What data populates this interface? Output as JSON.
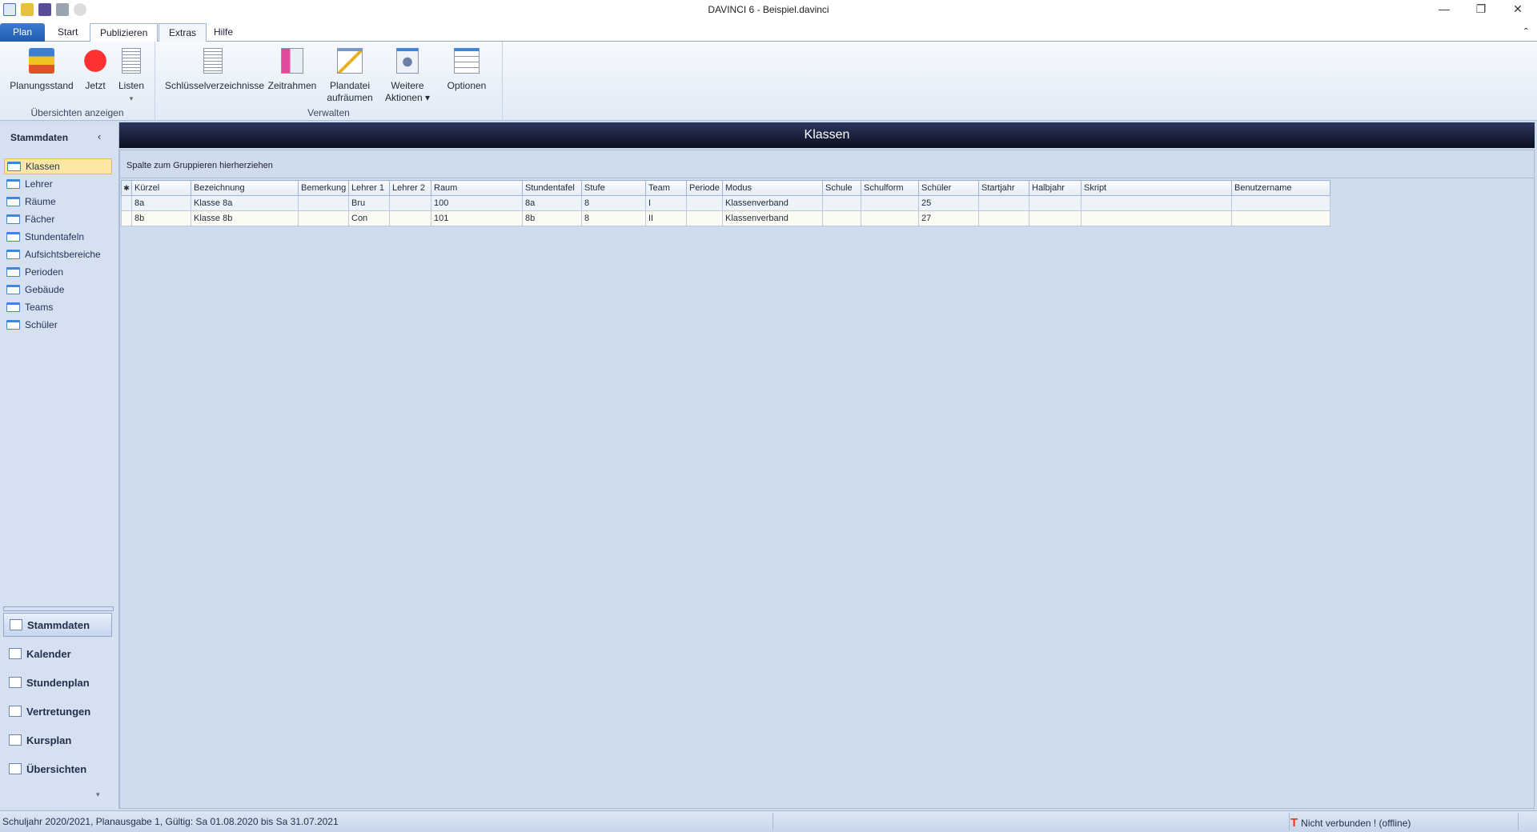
{
  "window": {
    "title": "DAVINCI 6 - Beispiel.davinci",
    "minimize": "—",
    "restore": "❐",
    "close": "✕",
    "collapse_ribbon": "⌃"
  },
  "quick_access": [
    "app-icon",
    "open-icon",
    "save-icon",
    "print-icon",
    "refresh-icon"
  ],
  "tabs": [
    {
      "label": "Plan"
    },
    {
      "label": "Start"
    },
    {
      "label": "Publizieren"
    },
    {
      "label": "Extras",
      "selected": true
    },
    {
      "label": "Hilfe"
    }
  ],
  "ribbon": {
    "groups": [
      {
        "label": "Übersichten anzeigen",
        "buttons": [
          {
            "label": "Planungsstand",
            "icon": "blocks-icon"
          },
          {
            "label": "Jetzt",
            "icon": "record-icon"
          },
          {
            "label": "Listen",
            "icon": "list-icon",
            "dropdown": "▾"
          }
        ]
      },
      {
        "label": "Verwalten",
        "buttons": [
          {
            "label": "Schlüsselverzeichnisse",
            "icon": "document-icon"
          },
          {
            "label": "Zeitrahmen",
            "icon": "timeframe-icon"
          },
          {
            "label": "Plandatei",
            "label2": "aufräumen",
            "icon": "cleanup-icon"
          },
          {
            "label": "Weitere",
            "label2": "Aktionen ▾",
            "icon": "gear-icon"
          },
          {
            "label": "Optionen",
            "icon": "options-icon"
          }
        ]
      }
    ]
  },
  "sidebar": {
    "title": "Stammdaten",
    "collapse": "‹",
    "items": [
      {
        "label": "Klassen",
        "selected": true
      },
      {
        "label": "Lehrer"
      },
      {
        "label": "Räume"
      },
      {
        "label": "Fächer"
      },
      {
        "label": "Stundentafeln"
      },
      {
        "label": "Aufsichtsbereiche"
      },
      {
        "label": "Perioden"
      },
      {
        "label": "Gebäude"
      },
      {
        "label": "Teams"
      },
      {
        "label": "Schüler"
      }
    ],
    "modules": [
      {
        "label": "Stammdaten",
        "selected": true
      },
      {
        "label": "Kalender"
      },
      {
        "label": "Stundenplan"
      },
      {
        "label": "Vertretungen"
      },
      {
        "label": "Kursplan"
      },
      {
        "label": "Übersichten"
      }
    ],
    "more": "▾"
  },
  "main": {
    "title": "Klassen",
    "group_hint": "Spalte zum Gruppieren hierherziehen",
    "new_row_marker": "✱",
    "columns": [
      "Kürzel",
      "Bezeichnung",
      "Bemerkung",
      "Lehrer 1",
      "Lehrer 2",
      "Raum",
      "Stundentafel",
      "Stufe",
      "Team",
      "Periode",
      "Modus",
      "Schule",
      "Schulform",
      "Schüler",
      "Startjahr",
      "Halbjahr",
      "Skript",
      "Benutzername"
    ],
    "rows": [
      [
        "8a",
        "Klasse 8a",
        "",
        "Bru",
        "",
        "100",
        "8a",
        "8",
        "I",
        "",
        "Klassenverband",
        "",
        "",
        "25",
        "",
        "",
        "",
        ""
      ],
      [
        "8b",
        "Klasse 8b",
        "",
        "Con",
        "",
        "101",
        "8b",
        "8",
        "II",
        "",
        "Klassenverband",
        "",
        "",
        "27",
        "",
        "",
        "",
        ""
      ]
    ]
  },
  "status": {
    "left": "Schuljahr 2020/2021, Planausgabe 1, Gültig: Sa 01.08.2020 bis Sa 31.07.2021",
    "connection": "Nicht verbunden ! (offline)",
    "connection_color": "#e53a1e"
  }
}
